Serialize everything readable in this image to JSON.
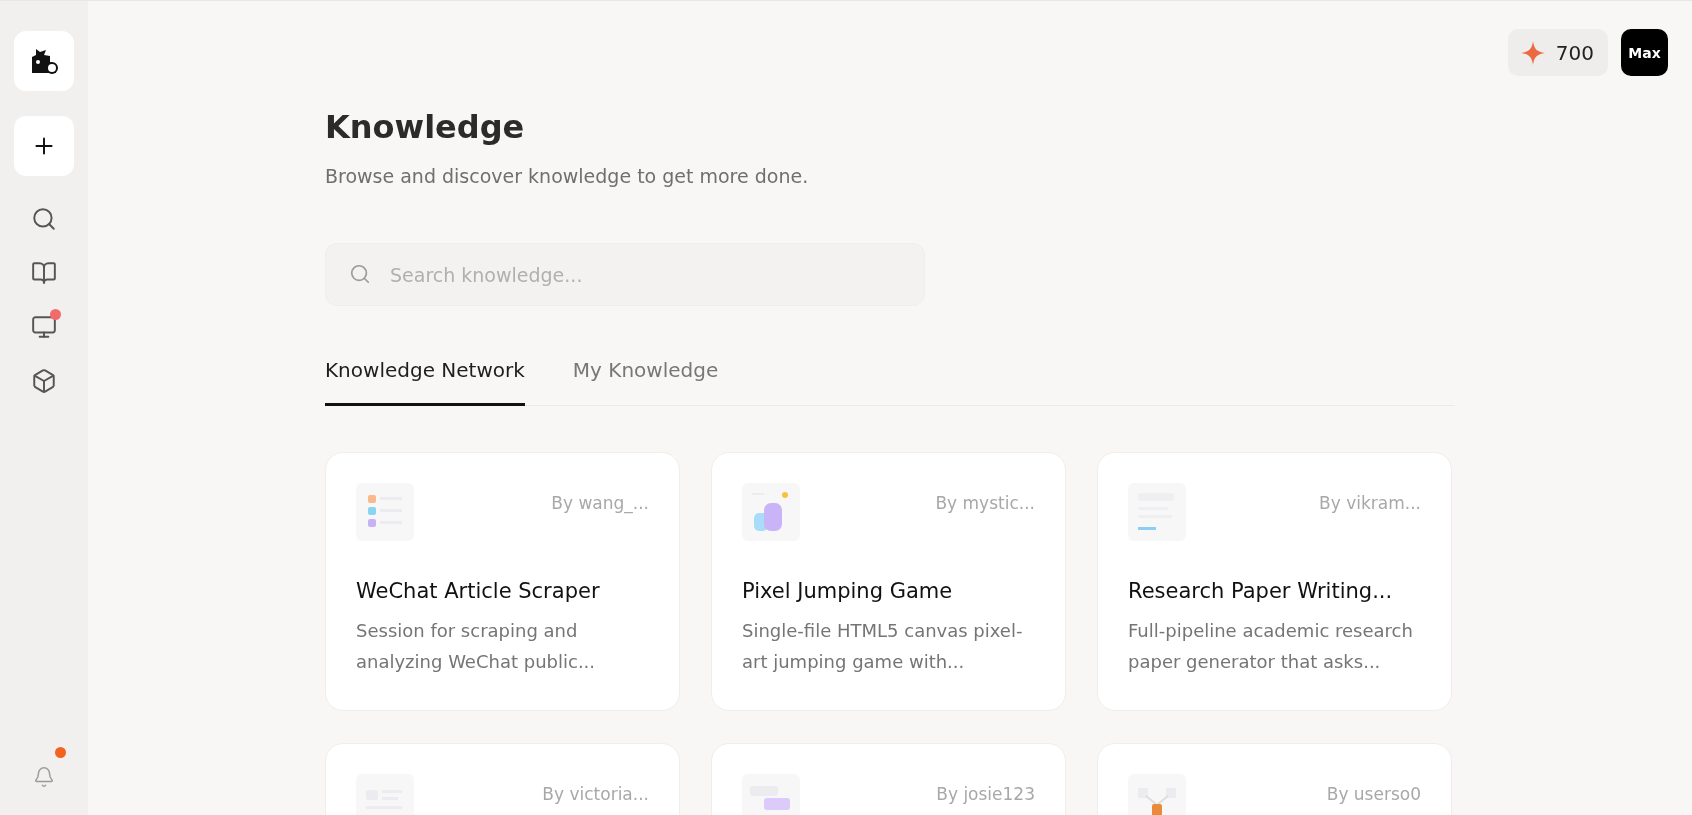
{
  "sidebar": {
    "items": [
      {
        "badge": false
      },
      {
        "badge": false
      },
      {
        "badge": true
      },
      {
        "badge": false
      }
    ],
    "bell": {
      "badge": true
    }
  },
  "topbar": {
    "credits": "700",
    "avatar": {
      "title": "Max"
    }
  },
  "page": {
    "title": "Knowledge",
    "subtitle": "Browse and discover knowledge to get more done."
  },
  "search": {
    "placeholder": "Search knowledge..."
  },
  "tabs": [
    {
      "label": "Knowledge Network",
      "selected": true
    },
    {
      "label": "My Knowledge",
      "selected": false
    }
  ],
  "cards": [
    {
      "kind": "list",
      "author": "By wang_...",
      "title": "WeChat Article Scraper",
      "description": "Session for scraping and analyzing WeChat public..."
    },
    {
      "kind": "chart",
      "author": "By mystic...",
      "title": "Pixel Jumping Game",
      "description": "Single-file HTML5 canvas pixel-art jumping game with..."
    },
    {
      "kind": "doc",
      "author": "By vikram...",
      "title": "Research Paper Writing...",
      "description": "Full-pipeline academic research paper generator that asks..."
    },
    {
      "kind": "page",
      "author": "By victoria..."
    },
    {
      "kind": "blocks",
      "author": "By josie123"
    },
    {
      "kind": "nodes",
      "author": "By userso0"
    }
  ]
}
